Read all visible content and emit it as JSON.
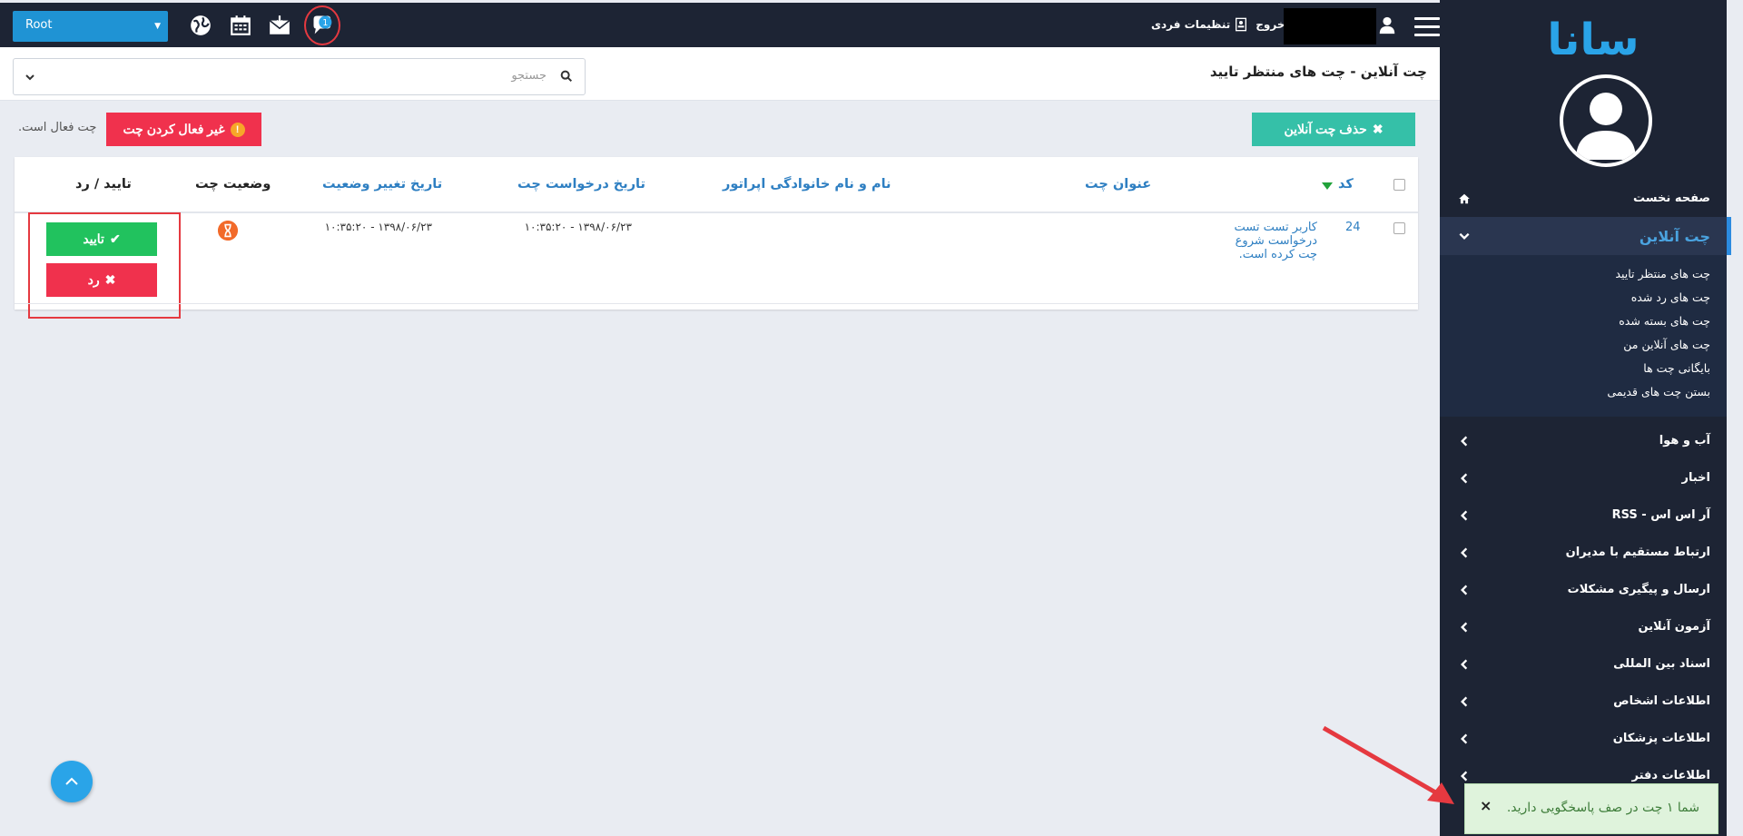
{
  "topbar": {
    "root_select": "Root",
    "settings_label": "تنظیمات فردی",
    "logout_label": "خروج"
  },
  "sidebar": {
    "logo_text": "سانا",
    "items": [
      {
        "label": "صفحه نخست",
        "icon": "home-icon"
      },
      {
        "label": "چت آنلاین",
        "icon": "chevron-down-icon"
      },
      {
        "label": "آب و هوا",
        "icon": "chevron-left-icon"
      },
      {
        "label": "اخبار",
        "icon": "chevron-left-icon"
      },
      {
        "label": "آر اس اس - RSS",
        "icon": "chevron-left-icon"
      },
      {
        "label": "ارتباط مستقیم با مدیران",
        "icon": "chevron-left-icon"
      },
      {
        "label": "ارسال و پیگیری مشکلات",
        "icon": "chevron-left-icon"
      },
      {
        "label": "آزمون آنلاین",
        "icon": "chevron-left-icon"
      },
      {
        "label": "اسناد بین المللی",
        "icon": "chevron-left-icon"
      },
      {
        "label": "اطلاعات اشخاص",
        "icon": "chevron-left-icon"
      },
      {
        "label": "اطلاعات پزشکان",
        "icon": "chevron-left-icon"
      },
      {
        "label": "اطلاعات دفتر",
        "icon": "chevron-left-icon"
      }
    ],
    "submenu": [
      "چت های منتظر تایید",
      "چت های رد شده",
      "چت های بسته شده",
      "چت های آنلاین من",
      "بایگانی چت ها",
      "بستن چت های قدیمی"
    ]
  },
  "header": {
    "page_title": "چت آنلاین - چت های منتظر تایید",
    "search_placeholder": "جستجو"
  },
  "actions": {
    "delete_label": "حذف چت آنلاین",
    "deactivate_label": "غیر فعال کردن چت",
    "chat_status_text": "چت فعال است."
  },
  "table": {
    "columns": [
      "کد",
      "عنوان چت",
      "نام و نام خانوادگی اپراتور",
      "تاریخ درخواست چت",
      "تاریخ تغییر وضعیت",
      "وضعیت چت",
      "تایید / رد"
    ],
    "rows": [
      {
        "code": "24",
        "title": "کاربر تست تست درخواست شروع چت کرده است.",
        "operator": "",
        "request_date": "۱۳۹۸/۰۶/۲۳ - ۱۰:۳۵:۲۰",
        "change_date": "۱۳۹۸/۰۶/۲۳ - ۱۰:۳۵:۲۰",
        "approve_label": "تایید",
        "reject_label": "رد"
      }
    ]
  },
  "toast": {
    "message": "شما ۱ چت در صف پاسخگویی دارید.",
    "close": "×"
  },
  "colors": {
    "sidebar_bg": "#1d2434",
    "accent_blue": "#1f93d4",
    "teal": "#35c0a8",
    "red": "#f0314d",
    "green": "#21c25e",
    "highlight_red": "#e53940"
  }
}
